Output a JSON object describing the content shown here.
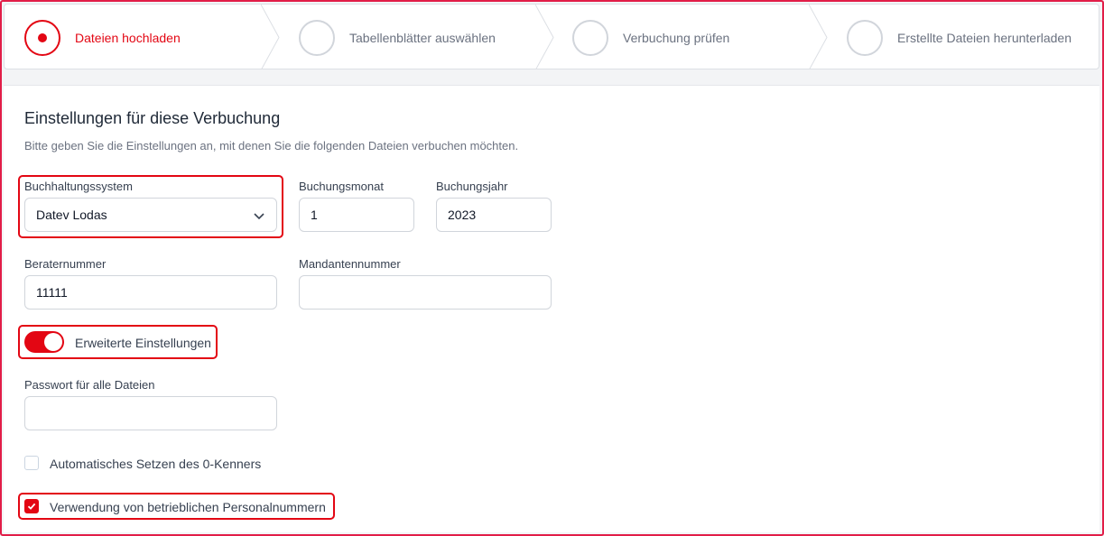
{
  "stepper": {
    "steps": [
      {
        "label": "Dateien hochladen",
        "active": true
      },
      {
        "label": "Tabellenblätter auswählen",
        "active": false
      },
      {
        "label": "Verbuchung prüfen",
        "active": false
      },
      {
        "label": "Erstellte Dateien herunterladen",
        "active": false
      }
    ]
  },
  "form": {
    "title": "Einstellungen für diese Verbuchung",
    "subtitle": "Bitte geben Sie die Einstellungen an, mit denen Sie die folgenden Dateien verbuchen möchten.",
    "accounting_system": {
      "label": "Buchhaltungssystem",
      "value": "Datev Lodas"
    },
    "booking_month": {
      "label": "Buchungsmonat",
      "value": "1"
    },
    "booking_year": {
      "label": "Buchungsjahr",
      "value": "2023"
    },
    "advisor_number": {
      "label": "Beraternummer",
      "value": "11111"
    },
    "client_number": {
      "label": "Mandantennummer",
      "value": ""
    },
    "advanced_settings": {
      "label": "Erweiterte Einstellungen",
      "enabled": true
    },
    "password": {
      "label": "Passwort für alle Dateien",
      "value": ""
    },
    "auto_zero_flag": {
      "label": "Automatisches Setzen des 0-Kenners",
      "checked": false
    },
    "company_personnel_numbers": {
      "label": "Verwendung von betrieblichen Personalnummern",
      "checked": true
    }
  },
  "colors": {
    "accent": "#e30613",
    "border": "#d1d5db",
    "muted_text": "#6b7280"
  }
}
